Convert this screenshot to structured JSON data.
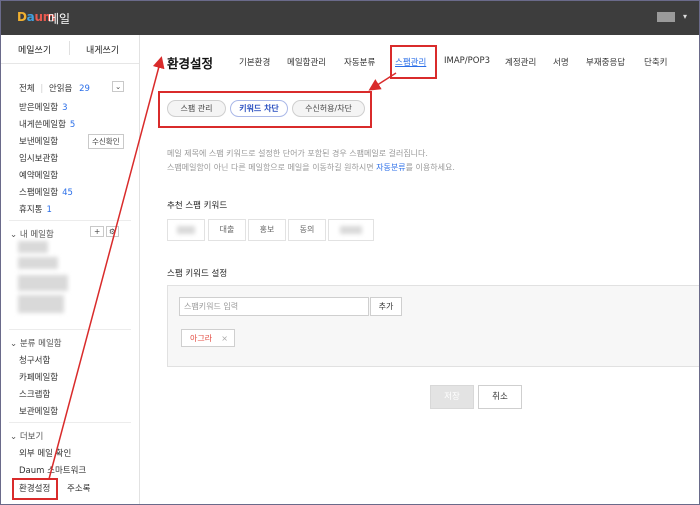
{
  "header": {
    "logo": {
      "d": "D",
      "a": "a",
      "u": "u",
      "m": "m"
    },
    "title": "메일",
    "user_caret": "▾"
  },
  "sidebar": {
    "compose": {
      "mail_label": "메일쓰기",
      "self_label": "내게쓰기"
    },
    "filter": {
      "all": "전체",
      "unread_label": "안읽음",
      "unread_count": "29",
      "toggle": "⌄"
    },
    "folders": [
      {
        "label": "받은메일함",
        "count": "3"
      },
      {
        "label": "내게쓴메일함",
        "count": "5"
      },
      {
        "label": "보낸메일함",
        "count": ""
      },
      {
        "label": "임시보관함",
        "count": ""
      },
      {
        "label": "예약메일함",
        "count": ""
      },
      {
        "label": "스팸메일함",
        "count": "45"
      },
      {
        "label": "휴지통",
        "count": "1"
      }
    ],
    "confirm_receipt": "수신확인",
    "my_mailbox": {
      "label": "내 메일함",
      "add": "+",
      "settings": "⚙",
      "caret": "⌄"
    },
    "classified": {
      "label": "분류 메일함",
      "caret": "⌄",
      "items": [
        "청구서함",
        "카페메일함",
        "스크랩함",
        "보관메일함"
      ]
    },
    "more": {
      "label": "더보기",
      "caret": "⌄",
      "items": [
        "외부 메일 확인",
        "Daum 스마트워크"
      ]
    },
    "bottom": {
      "settings": "환경설정",
      "address": "주소록"
    }
  },
  "main": {
    "title": "환경설정",
    "tabs": [
      "기본환경",
      "메일함관리",
      "자동분류",
      "스팸관리",
      "IMAP/POP3",
      "계정관리",
      "서명",
      "부재중응답",
      "단축키"
    ],
    "active_tab": "스팸관리",
    "subtabs": [
      "스팸 관리",
      "키워드 차단",
      "수신허용/차단"
    ],
    "desc_line1": "메일 제목에 스팸 키워드로 설정한 단어가 포함된 경우 스팸메일로 걸러집니다.",
    "desc_line2_pre": "스팸메일함이 아닌 다른 메일함으로 메일을 이동하길 원하시면",
    "desc_line2_link": "자동분류",
    "desc_line2_post": "를 이용하세요.",
    "recommend_title": "추천 스팸 키워드",
    "recommend_chips": [
      "",
      "대출",
      "홍보",
      "동의",
      ""
    ],
    "setting_title": "스팸 키워드 설정",
    "input_placeholder": "스팸키워드 입력",
    "add_button": "추가",
    "keywords": [
      {
        "label": "아그라",
        "remove": "×"
      }
    ],
    "save_button": "저장",
    "cancel_button": "취소"
  },
  "colors": {
    "accent": "#2a6ee8",
    "annotation": "#d92b2b",
    "topbar": "#3d3d3d"
  }
}
